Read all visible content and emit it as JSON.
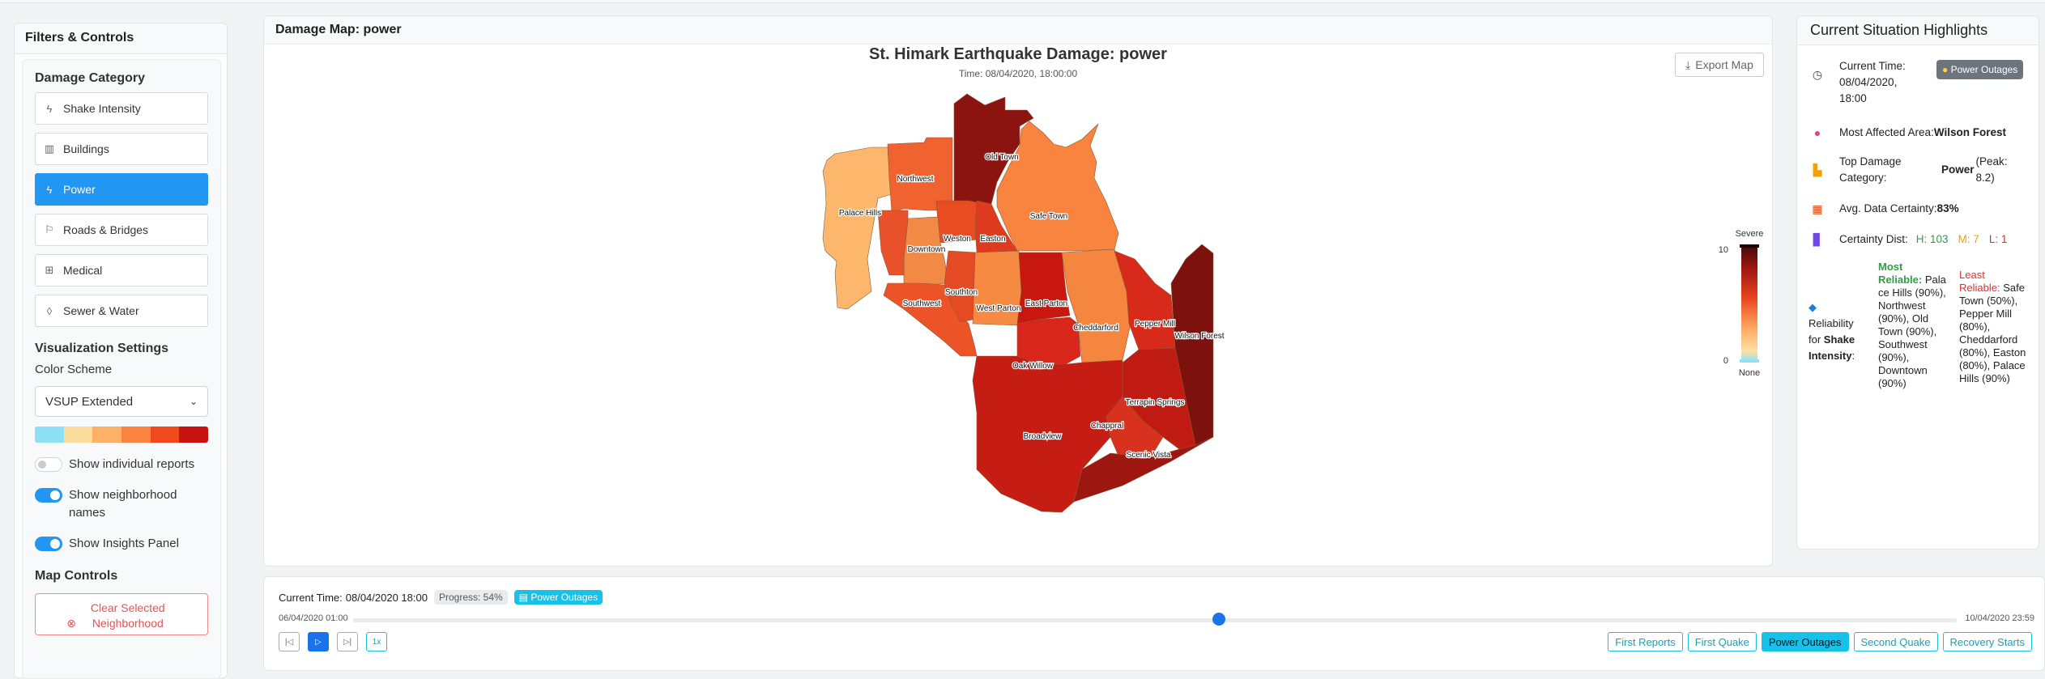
{
  "left_panel": {
    "title": "Filters & Controls",
    "damage_category_title": "Damage Category",
    "categories": [
      {
        "label": "Shake Intensity",
        "icon": "lightning-icon"
      },
      {
        "label": "Buildings",
        "icon": "building-icon"
      },
      {
        "label": "Power",
        "icon": "lightning-icon"
      },
      {
        "label": "Roads & Bridges",
        "icon": "signpost-icon"
      },
      {
        "label": "Medical",
        "icon": "hospital-icon"
      },
      {
        "label": "Sewer & Water",
        "icon": "droplet-icon"
      }
    ],
    "selected_category": "Power",
    "viz_title": "Visualization Settings",
    "color_scheme_label": "Color Scheme",
    "color_scheme_value": "VSUP Extended",
    "swatch_colors": [
      "#8ee0f5",
      "#fbdc9c",
      "#fdb067",
      "#fb8341",
      "#ef4a1e",
      "#c8120f"
    ],
    "toggles": [
      {
        "label": "Show individual reports",
        "on": false
      },
      {
        "label": "Show neighborhood names",
        "on": true
      },
      {
        "label": "Show Insights Panel",
        "on": true
      }
    ],
    "map_controls_title": "Map Controls",
    "clear_button": "Clear Selected Neighborhood"
  },
  "map": {
    "header": "Damage Map: power",
    "title": "St. Himark Earthquake Damage: power",
    "subtitle": "Time: 08/04/2020, 18:00:00",
    "export_label": "Export Map",
    "neighborhood_labels": [
      "Old Town",
      "Northwest",
      "Palace Hills",
      "Safe Town",
      "Weston",
      "Easton",
      "Downtown",
      "Southton",
      "Southwest",
      "East Parton",
      "West Parton",
      "Cheddarford",
      "Pepper Mill",
      "Wilson Forest",
      "Oak Willow",
      "Terrapin Springs",
      "Chappral",
      "Broadview",
      "Scenic Vista"
    ],
    "legend": {
      "top_label": "Severe",
      "max": "10",
      "min": "0",
      "bottom_label": "None"
    }
  },
  "timeline": {
    "current_label": "Current Time:",
    "current_value": "08/04/2020 18:00",
    "progress": "Progress: 54%",
    "progress_fraction": 0.54,
    "event_badge": "Power Outages",
    "start": "06/04/2020 01:00",
    "end": "10/04/2020 23:59",
    "speed": "1x",
    "events": [
      "First Reports",
      "First Quake",
      "Power Outages",
      "Second Quake",
      "Recovery Starts"
    ],
    "active_event": "Power Outages"
  },
  "insights": {
    "title": "Current Situation Highlights",
    "time_label": "Current Time:",
    "time_value_1": "08/04/2020,",
    "time_value_2": "18:00",
    "time_badge": "Power Outages",
    "area_label": "Most Affected Area:",
    "area_value": "Wilson Forest",
    "top_label_1": "Top Damage",
    "top_label_2": "Category:",
    "top_value": "Power",
    "top_peak_1": "(Peak:",
    "top_peak_2": "8.2)",
    "certainty_label": "Avg. Data Certainty:",
    "certainty_value": "83%",
    "dist_label": "Certainty Dist:",
    "dist_h": "H: 103",
    "dist_m": "M: 7",
    "dist_l": "L: 1",
    "reliability_label_1": "Reliability",
    "reliability_label_2": "for",
    "reliability_category_1": "Shake",
    "reliability_category_2": "Intensity",
    "reliability_colon": ":",
    "most_reliable_title_1": "Most",
    "most_reliable_title_2": "Reliable:",
    "most_reliable_lines": [
      "Pala",
      "ce Hills (90%),",
      "Northwest",
      "(90%), Old",
      "Town (90%),",
      "Southwest",
      "(90%),",
      "Downtown",
      "(90%)"
    ],
    "least_reliable_title_1": "Least",
    "least_reliable_title_2": "Reliable:",
    "least_reliable_lines": [
      "Safe",
      "Town (50%),",
      "Pepper Mill",
      "(80%),",
      "Cheddarford",
      "(80%), Easton",
      "(80%), Palace",
      "Hills (90%)"
    ]
  }
}
